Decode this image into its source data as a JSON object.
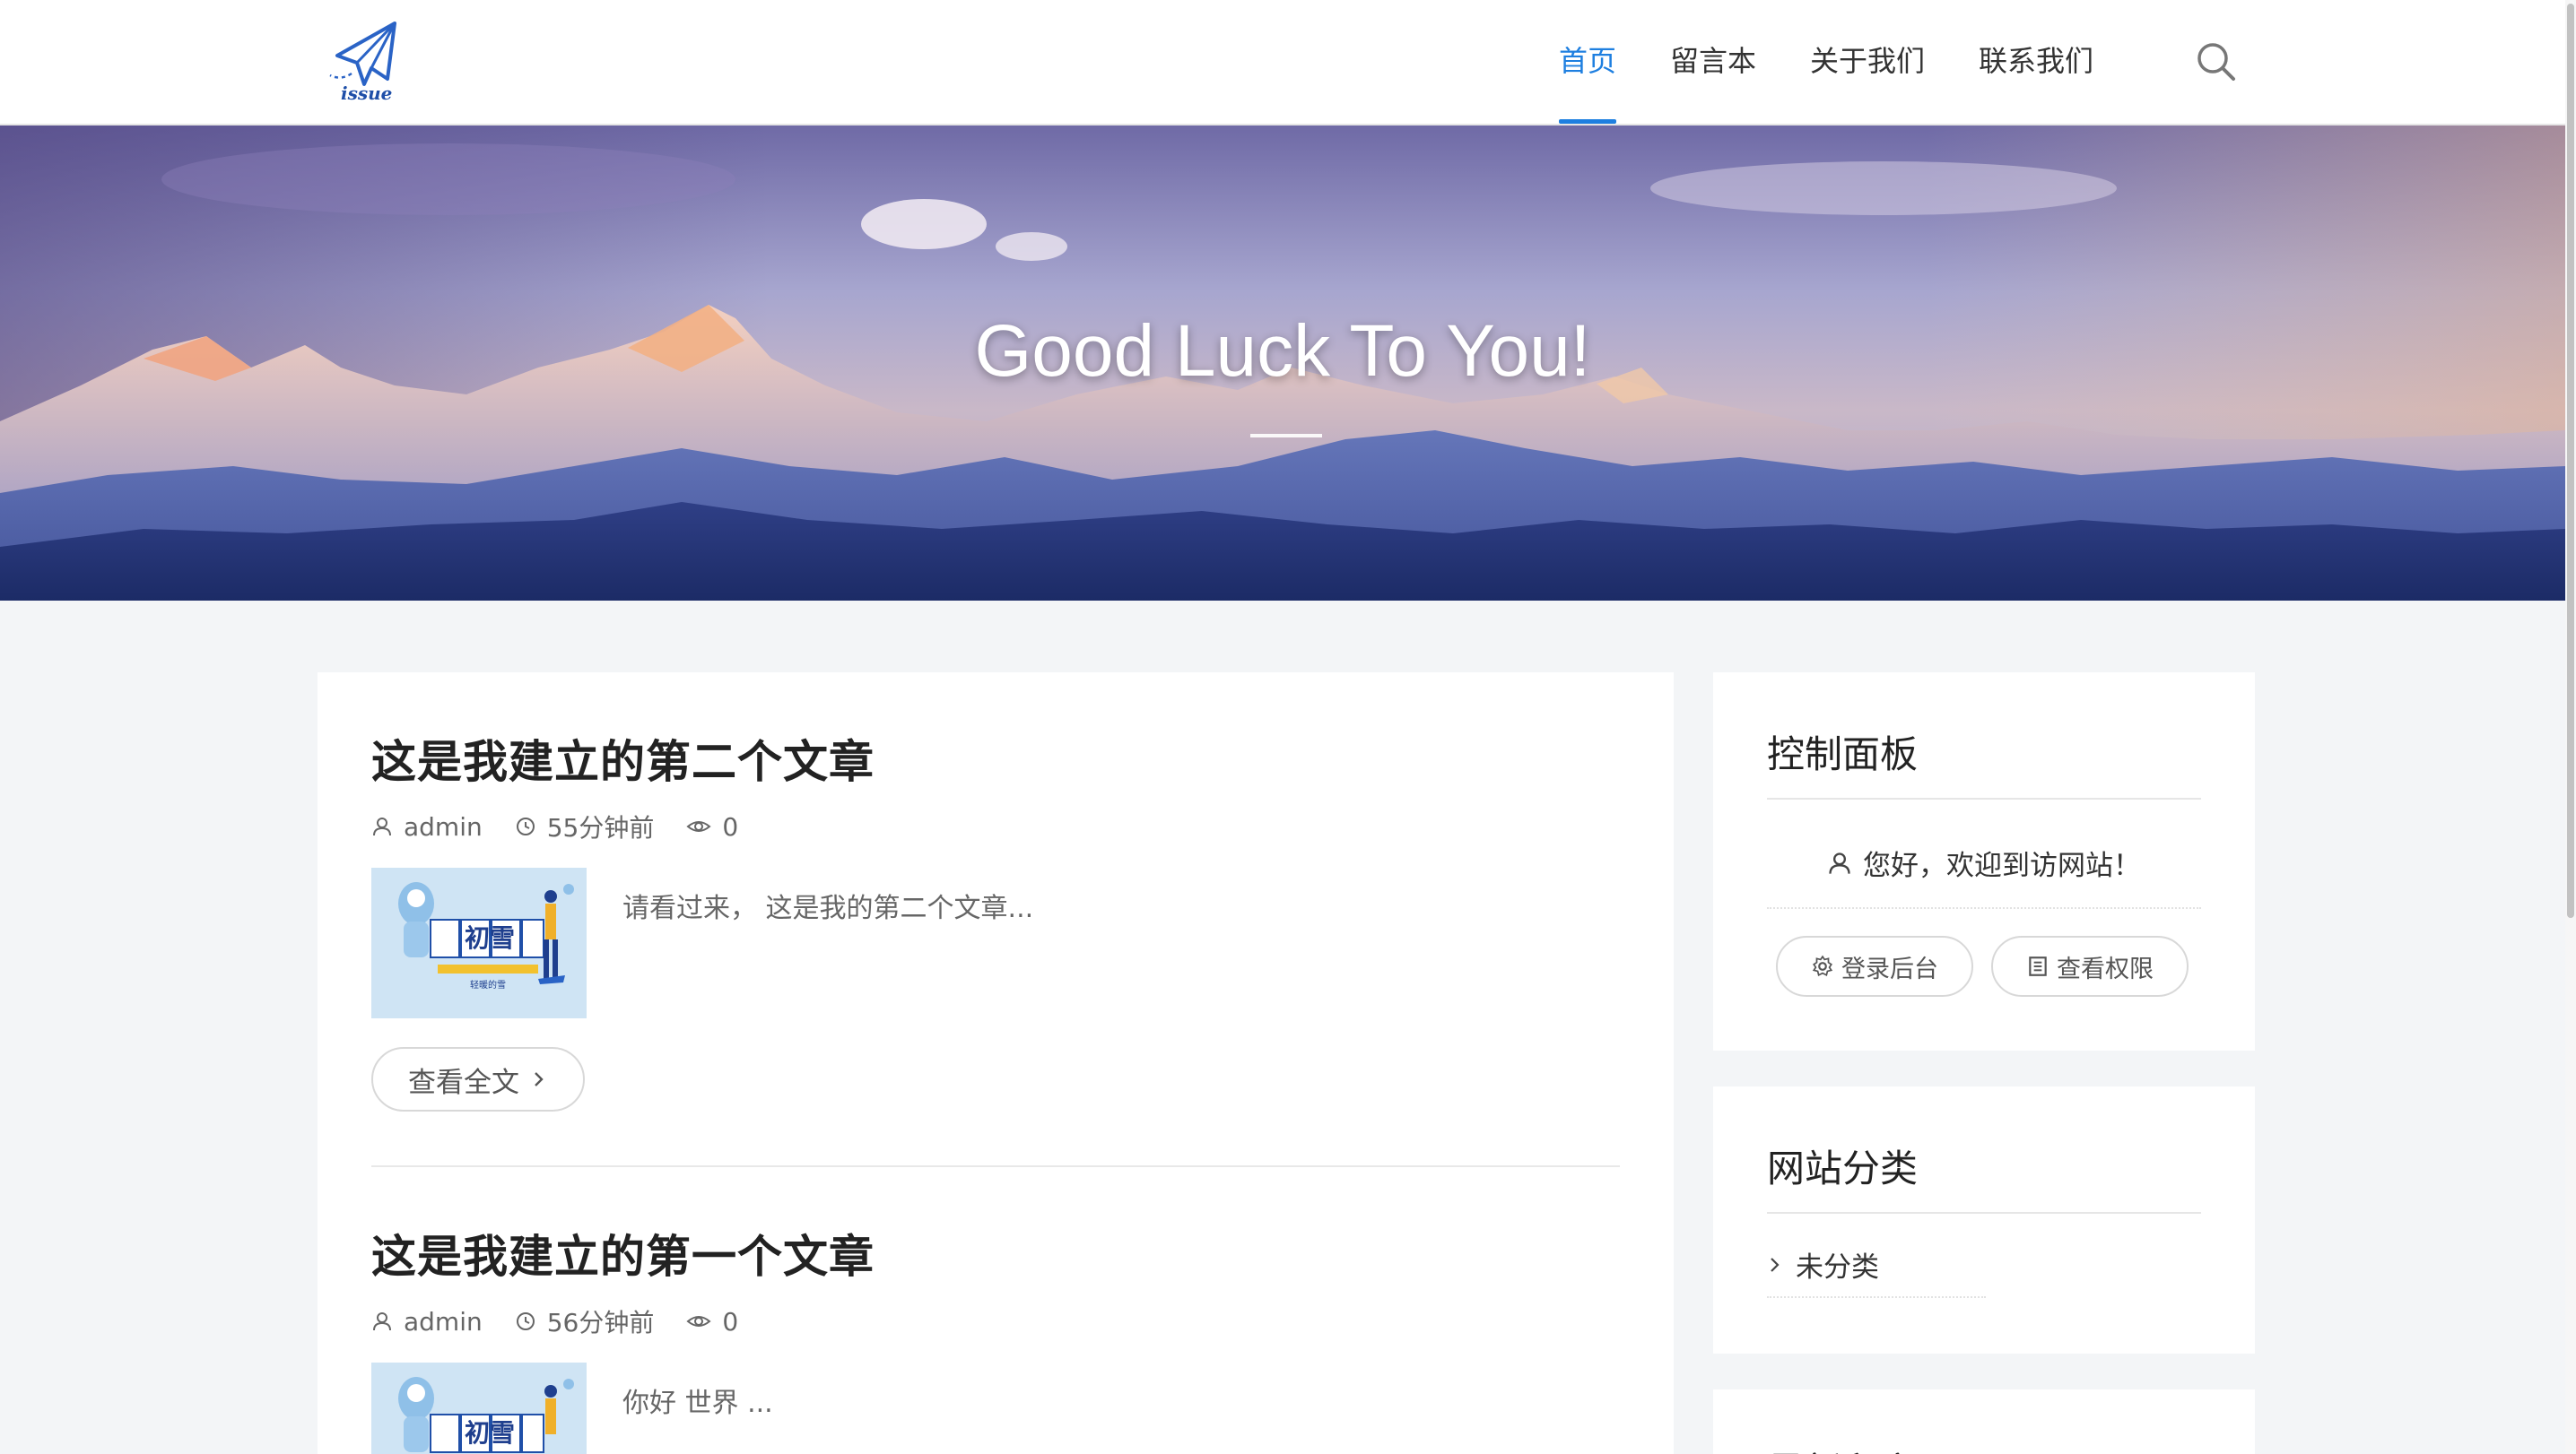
{
  "nav": {
    "items": [
      {
        "label": "首页",
        "active": true
      },
      {
        "label": "留言本",
        "active": false
      },
      {
        "label": "关于我们",
        "active": false
      },
      {
        "label": "联系我们",
        "active": false
      }
    ],
    "logo_text": "issue",
    "search_icon": "search-icon"
  },
  "hero": {
    "title": "Good Luck To You!"
  },
  "posts": [
    {
      "title": "这是我建立的第二个文章",
      "author": "admin",
      "time": "55分钟前",
      "views": "0",
      "excerpt": "请看过来， 这是我的第二个文章...",
      "thumb_text": "初雪",
      "thumb_sub": "轻暖的雪",
      "read_more": "查看全文"
    },
    {
      "title": "这是我建立的第一个文章",
      "author": "admin",
      "time": "56分钟前",
      "views": "0",
      "excerpt": "你好  世界 ...",
      "thumb_text": "初雪"
    }
  ],
  "sidebar": {
    "control": {
      "title": "控制面板",
      "welcome": "您好，欢迎到访网站！",
      "login_label": "登录后台",
      "perm_label": "查看权限"
    },
    "categories": {
      "title": "网站分类",
      "items": [
        "未分类"
      ]
    },
    "third": {
      "title": "最新留言"
    }
  },
  "colors": {
    "accent": "#1e7fe0",
    "background": "#f3f5f7"
  }
}
